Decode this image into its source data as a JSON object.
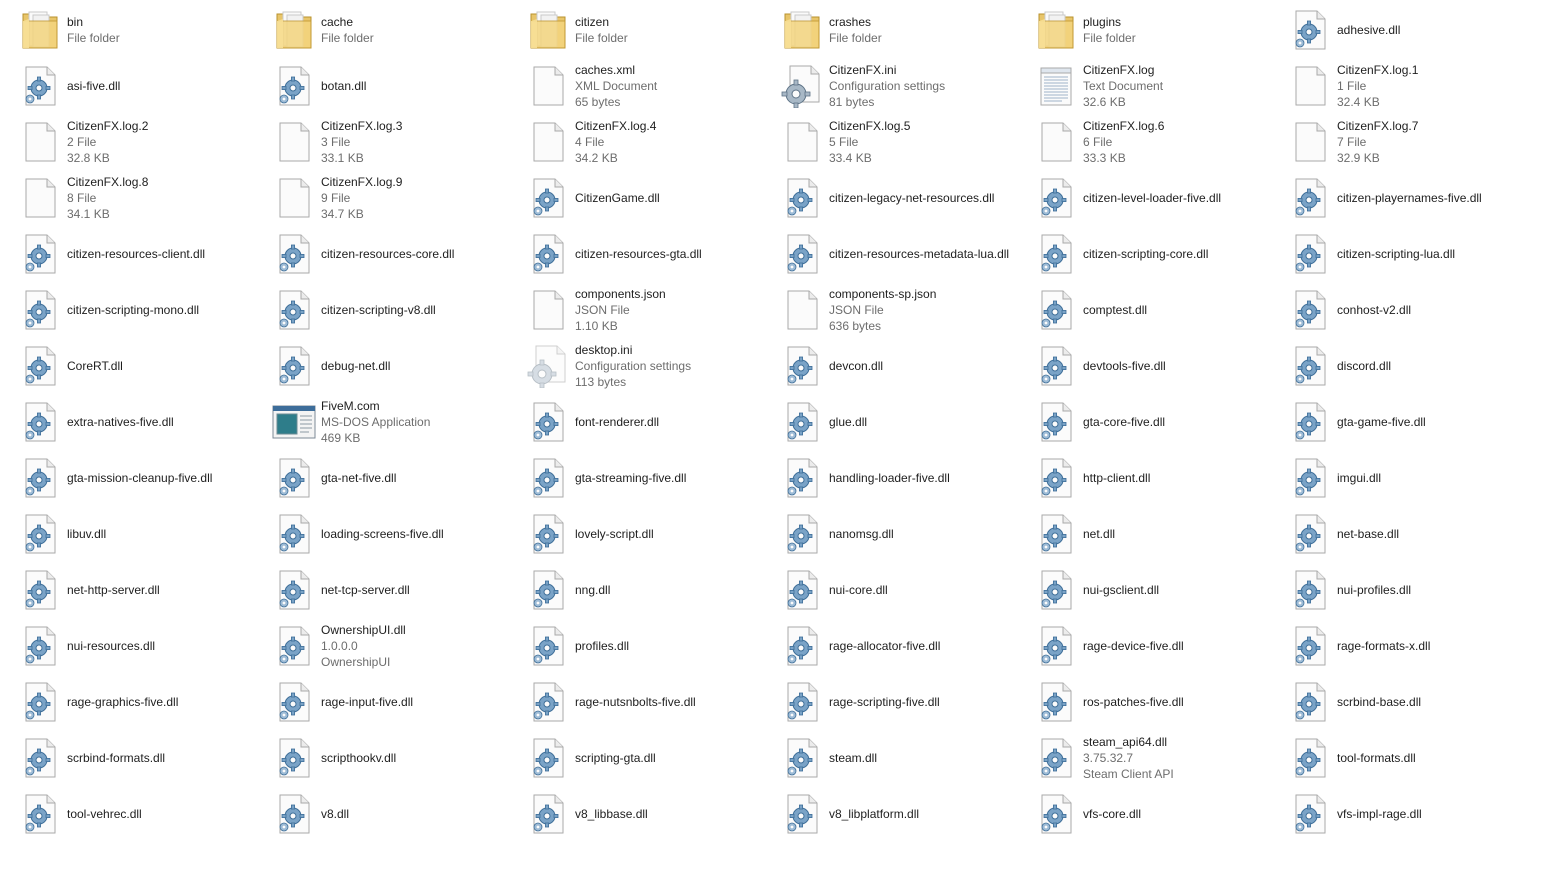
{
  "items": [
    {
      "name": "bin",
      "lines": [
        "File folder"
      ],
      "icon": "folder-icon"
    },
    {
      "name": "cache",
      "lines": [
        "File folder"
      ],
      "icon": "folder-icon"
    },
    {
      "name": "citizen",
      "lines": [
        "File folder"
      ],
      "icon": "folder-icon"
    },
    {
      "name": "crashes",
      "lines": [
        "File folder"
      ],
      "icon": "folder-icon"
    },
    {
      "name": "plugins",
      "lines": [
        "File folder"
      ],
      "icon": "folder-icon"
    },
    {
      "name": "adhesive.dll",
      "lines": [],
      "icon": "dll-icon"
    },
    {
      "name": "asi-five.dll",
      "lines": [],
      "icon": "dll-icon"
    },
    {
      "name": "botan.dll",
      "lines": [],
      "icon": "dll-icon"
    },
    {
      "name": "caches.xml",
      "lines": [
        "XML Document",
        "65 bytes"
      ],
      "icon": "blank-file-icon"
    },
    {
      "name": "CitizenFX.ini",
      "lines": [
        "Configuration settings",
        "81 bytes"
      ],
      "icon": "settings-file-icon"
    },
    {
      "name": "CitizenFX.log",
      "lines": [
        "Text Document",
        "32.6 KB"
      ],
      "icon": "text-file-icon"
    },
    {
      "name": "CitizenFX.log.1",
      "lines": [
        "1 File",
        "32.4 KB"
      ],
      "icon": "blank-file-icon"
    },
    {
      "name": "CitizenFX.log.2",
      "lines": [
        "2 File",
        "32.8 KB"
      ],
      "icon": "blank-file-icon"
    },
    {
      "name": "CitizenFX.log.3",
      "lines": [
        "3 File",
        "33.1 KB"
      ],
      "icon": "blank-file-icon"
    },
    {
      "name": "CitizenFX.log.4",
      "lines": [
        "4 File",
        "34.2 KB"
      ],
      "icon": "blank-file-icon"
    },
    {
      "name": "CitizenFX.log.5",
      "lines": [
        "5 File",
        "33.4 KB"
      ],
      "icon": "blank-file-icon"
    },
    {
      "name": "CitizenFX.log.6",
      "lines": [
        "6 File",
        "33.3 KB"
      ],
      "icon": "blank-file-icon"
    },
    {
      "name": "CitizenFX.log.7",
      "lines": [
        "7 File",
        "32.9 KB"
      ],
      "icon": "blank-file-icon"
    },
    {
      "name": "CitizenFX.log.8",
      "lines": [
        "8 File",
        "34.1 KB"
      ],
      "icon": "blank-file-icon"
    },
    {
      "name": "CitizenFX.log.9",
      "lines": [
        "9 File",
        "34.7 KB"
      ],
      "icon": "blank-file-icon"
    },
    {
      "name": "CitizenGame.dll",
      "lines": [],
      "icon": "dll-icon"
    },
    {
      "name": "citizen-legacy-net-resources.dll",
      "lines": [],
      "icon": "dll-icon"
    },
    {
      "name": "citizen-level-loader-five.dll",
      "lines": [],
      "icon": "dll-icon"
    },
    {
      "name": "citizen-playernames-five.dll",
      "lines": [],
      "icon": "dll-icon"
    },
    {
      "name": "citizen-resources-client.dll",
      "lines": [],
      "icon": "dll-icon"
    },
    {
      "name": "citizen-resources-core.dll",
      "lines": [],
      "icon": "dll-icon"
    },
    {
      "name": "citizen-resources-gta.dll",
      "lines": [],
      "icon": "dll-icon"
    },
    {
      "name": "citizen-resources-metadata-lua.dll",
      "lines": [],
      "icon": "dll-icon"
    },
    {
      "name": "citizen-scripting-core.dll",
      "lines": [],
      "icon": "dll-icon"
    },
    {
      "name": "citizen-scripting-lua.dll",
      "lines": [],
      "icon": "dll-icon"
    },
    {
      "name": "citizen-scripting-mono.dll",
      "lines": [],
      "icon": "dll-icon"
    },
    {
      "name": "citizen-scripting-v8.dll",
      "lines": [],
      "icon": "dll-icon"
    },
    {
      "name": "components.json",
      "lines": [
        "JSON File",
        "1.10 KB"
      ],
      "icon": "blank-file-icon"
    },
    {
      "name": "components-sp.json",
      "lines": [
        "JSON File",
        "636 bytes"
      ],
      "icon": "blank-file-icon"
    },
    {
      "name": "comptest.dll",
      "lines": [],
      "icon": "dll-icon"
    },
    {
      "name": "conhost-v2.dll",
      "lines": [],
      "icon": "dll-icon"
    },
    {
      "name": "CoreRT.dll",
      "lines": [],
      "icon": "dll-icon"
    },
    {
      "name": "debug-net.dll",
      "lines": [],
      "icon": "dll-icon"
    },
    {
      "name": "desktop.ini",
      "lines": [
        "Configuration settings",
        "113 bytes"
      ],
      "icon": "settings-file-faded-icon"
    },
    {
      "name": "devcon.dll",
      "lines": [],
      "icon": "dll-icon"
    },
    {
      "name": "devtools-five.dll",
      "lines": [],
      "icon": "dll-icon"
    },
    {
      "name": "discord.dll",
      "lines": [],
      "icon": "dll-icon"
    },
    {
      "name": "extra-natives-five.dll",
      "lines": [],
      "icon": "dll-icon"
    },
    {
      "name": "FiveM.com",
      "lines": [
        "MS-DOS Application",
        "469 KB"
      ],
      "icon": "application-icon"
    },
    {
      "name": "font-renderer.dll",
      "lines": [],
      "icon": "dll-icon"
    },
    {
      "name": "glue.dll",
      "lines": [],
      "icon": "dll-icon"
    },
    {
      "name": "gta-core-five.dll",
      "lines": [],
      "icon": "dll-icon"
    },
    {
      "name": "gta-game-five.dll",
      "lines": [],
      "icon": "dll-icon"
    },
    {
      "name": "gta-mission-cleanup-five.dll",
      "lines": [],
      "icon": "dll-icon"
    },
    {
      "name": "gta-net-five.dll",
      "lines": [],
      "icon": "dll-icon"
    },
    {
      "name": "gta-streaming-five.dll",
      "lines": [],
      "icon": "dll-icon"
    },
    {
      "name": "handling-loader-five.dll",
      "lines": [],
      "icon": "dll-icon"
    },
    {
      "name": "http-client.dll",
      "lines": [],
      "icon": "dll-icon"
    },
    {
      "name": "imgui.dll",
      "lines": [],
      "icon": "dll-icon"
    },
    {
      "name": "libuv.dll",
      "lines": [],
      "icon": "dll-icon"
    },
    {
      "name": "loading-screens-five.dll",
      "lines": [],
      "icon": "dll-icon"
    },
    {
      "name": "lovely-script.dll",
      "lines": [],
      "icon": "dll-icon"
    },
    {
      "name": "nanomsg.dll",
      "lines": [],
      "icon": "dll-icon"
    },
    {
      "name": "net.dll",
      "lines": [],
      "icon": "dll-icon"
    },
    {
      "name": "net-base.dll",
      "lines": [],
      "icon": "dll-icon"
    },
    {
      "name": "net-http-server.dll",
      "lines": [],
      "icon": "dll-icon"
    },
    {
      "name": "net-tcp-server.dll",
      "lines": [],
      "icon": "dll-icon"
    },
    {
      "name": "nng.dll",
      "lines": [],
      "icon": "dll-icon"
    },
    {
      "name": "nui-core.dll",
      "lines": [],
      "icon": "dll-icon"
    },
    {
      "name": "nui-gsclient.dll",
      "lines": [],
      "icon": "dll-icon"
    },
    {
      "name": "nui-profiles.dll",
      "lines": [],
      "icon": "dll-icon"
    },
    {
      "name": "nui-resources.dll",
      "lines": [],
      "icon": "dll-icon"
    },
    {
      "name": "OwnershipUI.dll",
      "lines": [
        "1.0.0.0",
        "OwnershipUI"
      ],
      "icon": "dll-icon"
    },
    {
      "name": "profiles.dll",
      "lines": [],
      "icon": "dll-icon"
    },
    {
      "name": "rage-allocator-five.dll",
      "lines": [],
      "icon": "dll-icon"
    },
    {
      "name": "rage-device-five.dll",
      "lines": [],
      "icon": "dll-icon"
    },
    {
      "name": "rage-formats-x.dll",
      "lines": [],
      "icon": "dll-icon"
    },
    {
      "name": "rage-graphics-five.dll",
      "lines": [],
      "icon": "dll-icon"
    },
    {
      "name": "rage-input-five.dll",
      "lines": [],
      "icon": "dll-icon"
    },
    {
      "name": "rage-nutsnbolts-five.dll",
      "lines": [],
      "icon": "dll-icon"
    },
    {
      "name": "rage-scripting-five.dll",
      "lines": [],
      "icon": "dll-icon"
    },
    {
      "name": "ros-patches-five.dll",
      "lines": [],
      "icon": "dll-icon"
    },
    {
      "name": "scrbind-base.dll",
      "lines": [],
      "icon": "dll-icon"
    },
    {
      "name": "scrbind-formats.dll",
      "lines": [],
      "icon": "dll-icon"
    },
    {
      "name": "scripthookv.dll",
      "lines": [],
      "icon": "dll-icon"
    },
    {
      "name": "scripting-gta.dll",
      "lines": [],
      "icon": "dll-icon"
    },
    {
      "name": "steam.dll",
      "lines": [],
      "icon": "dll-icon"
    },
    {
      "name": "steam_api64.dll",
      "lines": [
        "3.75.32.7",
        "Steam Client API"
      ],
      "icon": "dll-icon"
    },
    {
      "name": "tool-formats.dll",
      "lines": [],
      "icon": "dll-icon"
    },
    {
      "name": "tool-vehrec.dll",
      "lines": [],
      "icon": "dll-icon"
    },
    {
      "name": "v8.dll",
      "lines": [],
      "icon": "dll-icon"
    },
    {
      "name": "v8_libbase.dll",
      "lines": [],
      "icon": "dll-icon"
    },
    {
      "name": "v8_libplatform.dll",
      "lines": [],
      "icon": "dll-icon"
    },
    {
      "name": "vfs-core.dll",
      "lines": [],
      "icon": "dll-icon"
    },
    {
      "name": "vfs-impl-rage.dll",
      "lines": [],
      "icon": "dll-icon"
    }
  ]
}
